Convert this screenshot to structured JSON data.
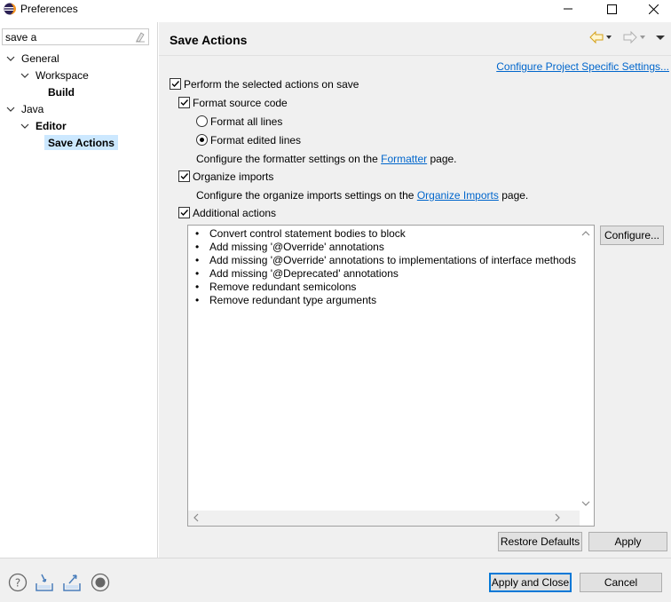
{
  "window": {
    "title": "Preferences",
    "icon": "eclipse-icon"
  },
  "sidebar": {
    "filter_value": "save a",
    "tree": [
      {
        "label": "General",
        "level": 0,
        "expanded": true
      },
      {
        "label": "Workspace",
        "level": 1,
        "expanded": true
      },
      {
        "label": "Build",
        "level": 2,
        "bold": true
      },
      {
        "label": "Java",
        "level": 0,
        "expanded": true
      },
      {
        "label": "Editor",
        "level": 1,
        "expanded": true,
        "bold": true
      },
      {
        "label": "Save Actions",
        "level": 2,
        "bold": true,
        "selected": true
      }
    ]
  },
  "page": {
    "title": "Save Actions",
    "project_settings_link": "Configure Project Specific Settings...",
    "perform_label": "Perform the selected actions on save",
    "perform_checked": true,
    "format_label": "Format source code",
    "format_checked": true,
    "format_all_label": "Format all lines",
    "format_all_selected": false,
    "format_edited_label": "Format edited lines",
    "format_edited_selected": true,
    "formatter_text_before": "Configure the formatter settings on the",
    "formatter_link": "Formatter",
    "formatter_text_after": "page.",
    "organize_label": "Organize imports",
    "organize_checked": true,
    "organize_text_before": "Configure the organize imports settings on the",
    "organize_link": "Organize Imports",
    "organize_text_after": "page.",
    "additional_label": "Additional actions",
    "additional_checked": true,
    "additional_actions": [
      "Convert control statement bodies to block",
      "Add missing '@Override' annotations",
      "Add missing '@Override' annotations to implementations of interface methods",
      "Add missing '@Deprecated' annotations",
      "Remove redundant semicolons",
      "Remove redundant type arguments"
    ],
    "configure_button": "Configure...",
    "restore_defaults_button": "Restore Defaults",
    "apply_button": "Apply"
  },
  "footer": {
    "apply_close_button": "Apply and Close",
    "cancel_button": "Cancel",
    "icons": [
      "help-icon",
      "import-icon",
      "export-icon",
      "record-icon"
    ]
  },
  "colors": {
    "accent": "#0078d7",
    "link": "#0066cc",
    "selection": "#cce8ff",
    "panel": "#f0f0f0"
  }
}
